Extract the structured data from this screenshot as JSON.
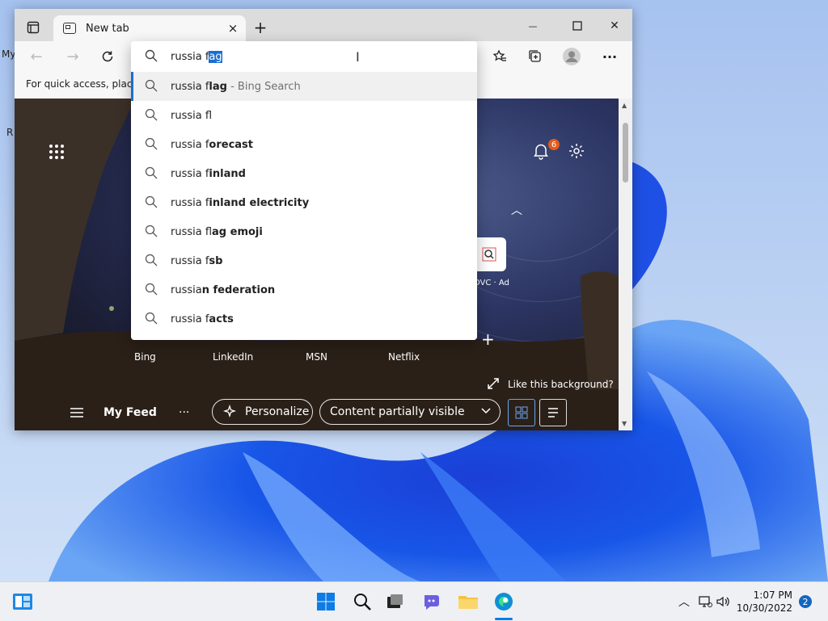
{
  "desktop": {
    "label_my": "My",
    "label_r": "R"
  },
  "browser": {
    "tab_title": "New tab",
    "tab_close": "×",
    "new_tab": "+",
    "minimize": "—",
    "close": "✕",
    "favorites_bar_text": "For quick access, place y"
  },
  "omnibox": {
    "typed_prefix": "russia f",
    "selected_completion": "ag",
    "suggestions": [
      {
        "prefix": "russia f",
        "bold": "lag",
        "suffix": " - Bing Search"
      },
      {
        "prefix": "russia fl",
        "bold": "",
        "suffix": ""
      },
      {
        "prefix": "russia f",
        "bold": "orecast",
        "suffix": ""
      },
      {
        "prefix": "russia f",
        "bold": "inland",
        "suffix": ""
      },
      {
        "prefix": "russia f",
        "bold": "inland electricity",
        "suffix": ""
      },
      {
        "prefix": "russia fl",
        "bold": "ag emoji",
        "suffix": ""
      },
      {
        "prefix": "russia f",
        "bold": "sb",
        "suffix": ""
      },
      {
        "prefix": "russia",
        "bold": "n f",
        "suffix": "ederation"
      },
      {
        "prefix": "russia f",
        "bold": "acts",
        "suffix": ""
      }
    ]
  },
  "newtab": {
    "notification_count": "6",
    "quick_links": [
      "Bing",
      "LinkedIn",
      "MSN",
      "Netflix"
    ],
    "ad_label": "DVC · Ad",
    "like_background": "Like this background?",
    "feed_label": "My Feed",
    "more_label": "···",
    "personalize_label": "Personalize",
    "content_visibility": "Content partially visible"
  },
  "taskbar": {
    "time": "1:07 PM",
    "date": "10/30/2022",
    "notifications": "2"
  }
}
